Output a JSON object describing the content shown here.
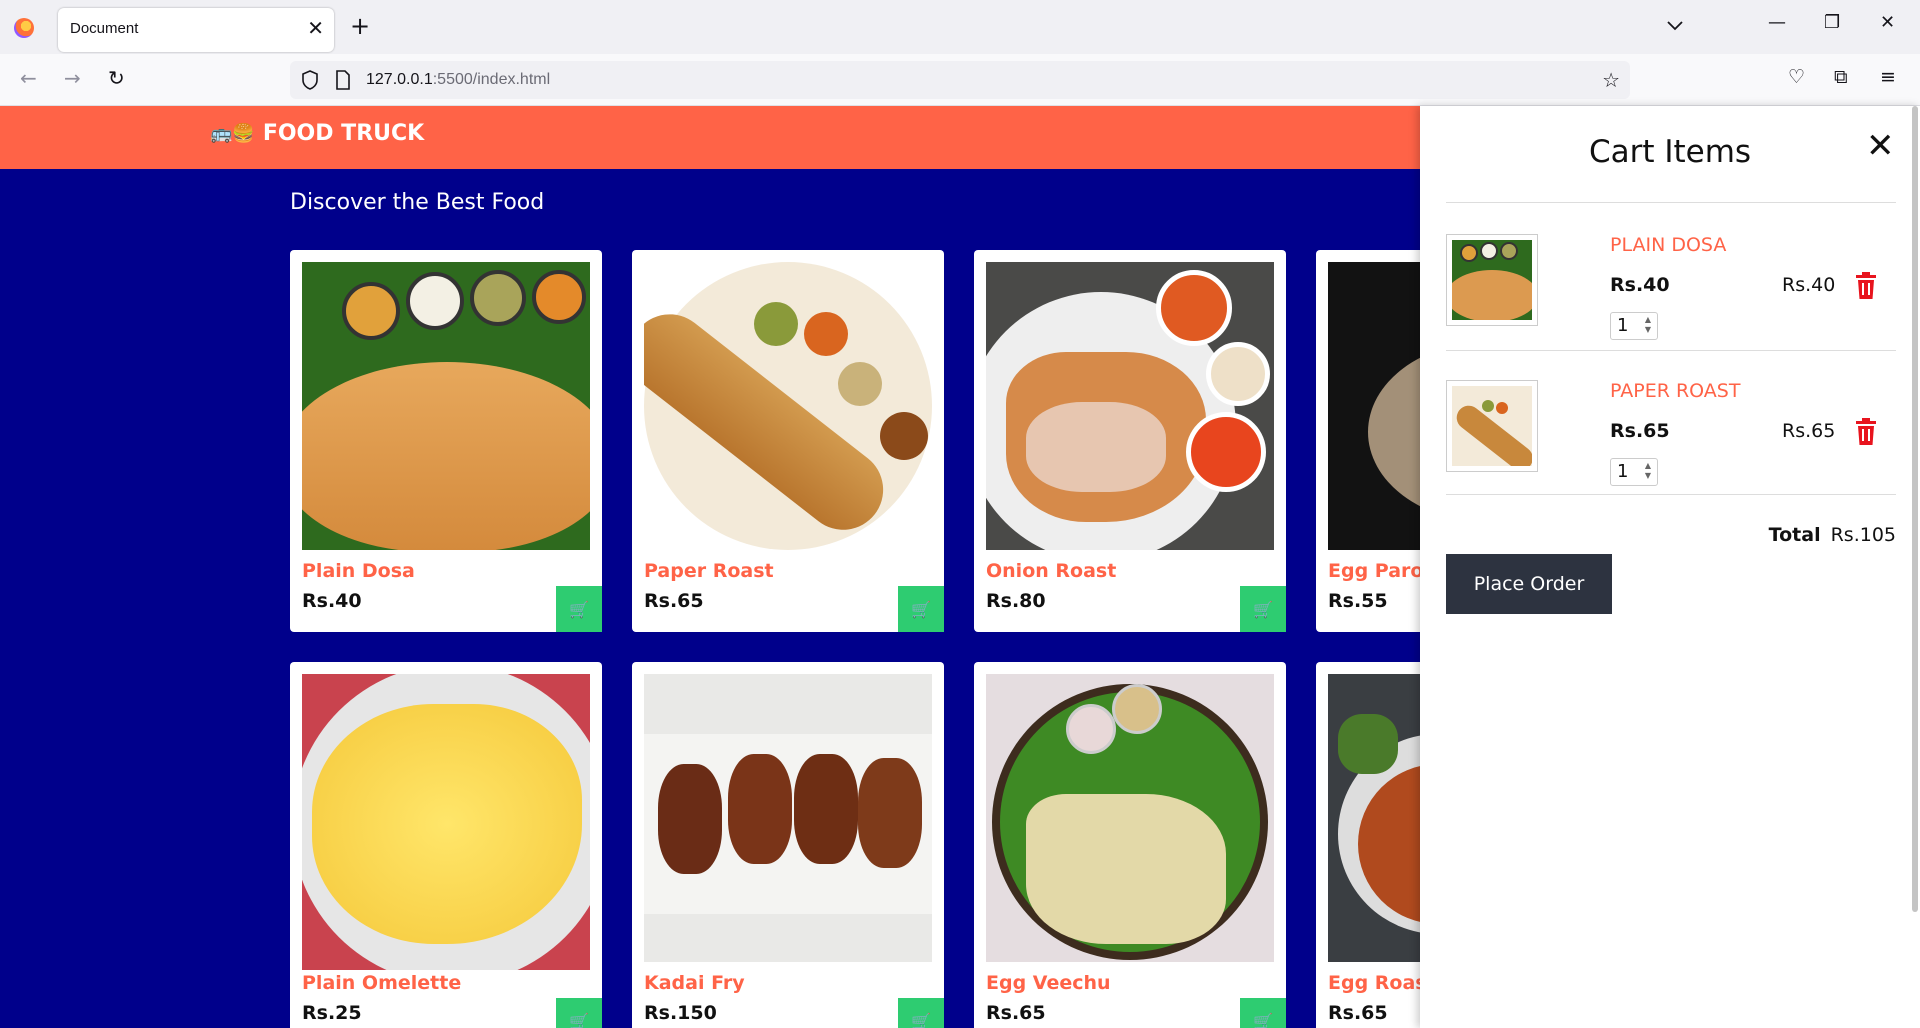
{
  "browser": {
    "tab_title": "Document",
    "url_host": "127.0.0.1",
    "url_rest": ":5500/index.html"
  },
  "site": {
    "brand": "FOOD TRUCK",
    "section_title": "Discover the Best Food"
  },
  "menu": [
    {
      "name": "Plain Dosa",
      "price": "Rs.40"
    },
    {
      "name": "Paper Roast",
      "price": "Rs.65"
    },
    {
      "name": "Onion Roast",
      "price": "Rs.80"
    },
    {
      "name": "Egg Parotta",
      "price": "Rs.55"
    },
    {
      "name": "Plain Omelette",
      "price": "Rs.25"
    },
    {
      "name": "Kadai Fry",
      "price": "Rs.150"
    },
    {
      "name": "Egg Veechu",
      "price": "Rs.65"
    },
    {
      "name": "Egg Roast",
      "price": "Rs.65"
    }
  ],
  "cart": {
    "title": "Cart Items",
    "items": [
      {
        "name": "PLAIN DOSA",
        "price": "Rs.40",
        "subtotal": "Rs.40",
        "qty": "1"
      },
      {
        "name": "PAPER ROAST",
        "price": "Rs.65",
        "subtotal": "Rs.65",
        "qty": "1"
      }
    ],
    "total_label": "Total",
    "total_value": "Rs.105",
    "place_order": "Place Order"
  },
  "colors": {
    "header": "#ff6347",
    "page_bg": "#00008b",
    "cart_button": "#2ecc71",
    "place_order_bg": "#2d3340",
    "trash": "#e8141e"
  }
}
